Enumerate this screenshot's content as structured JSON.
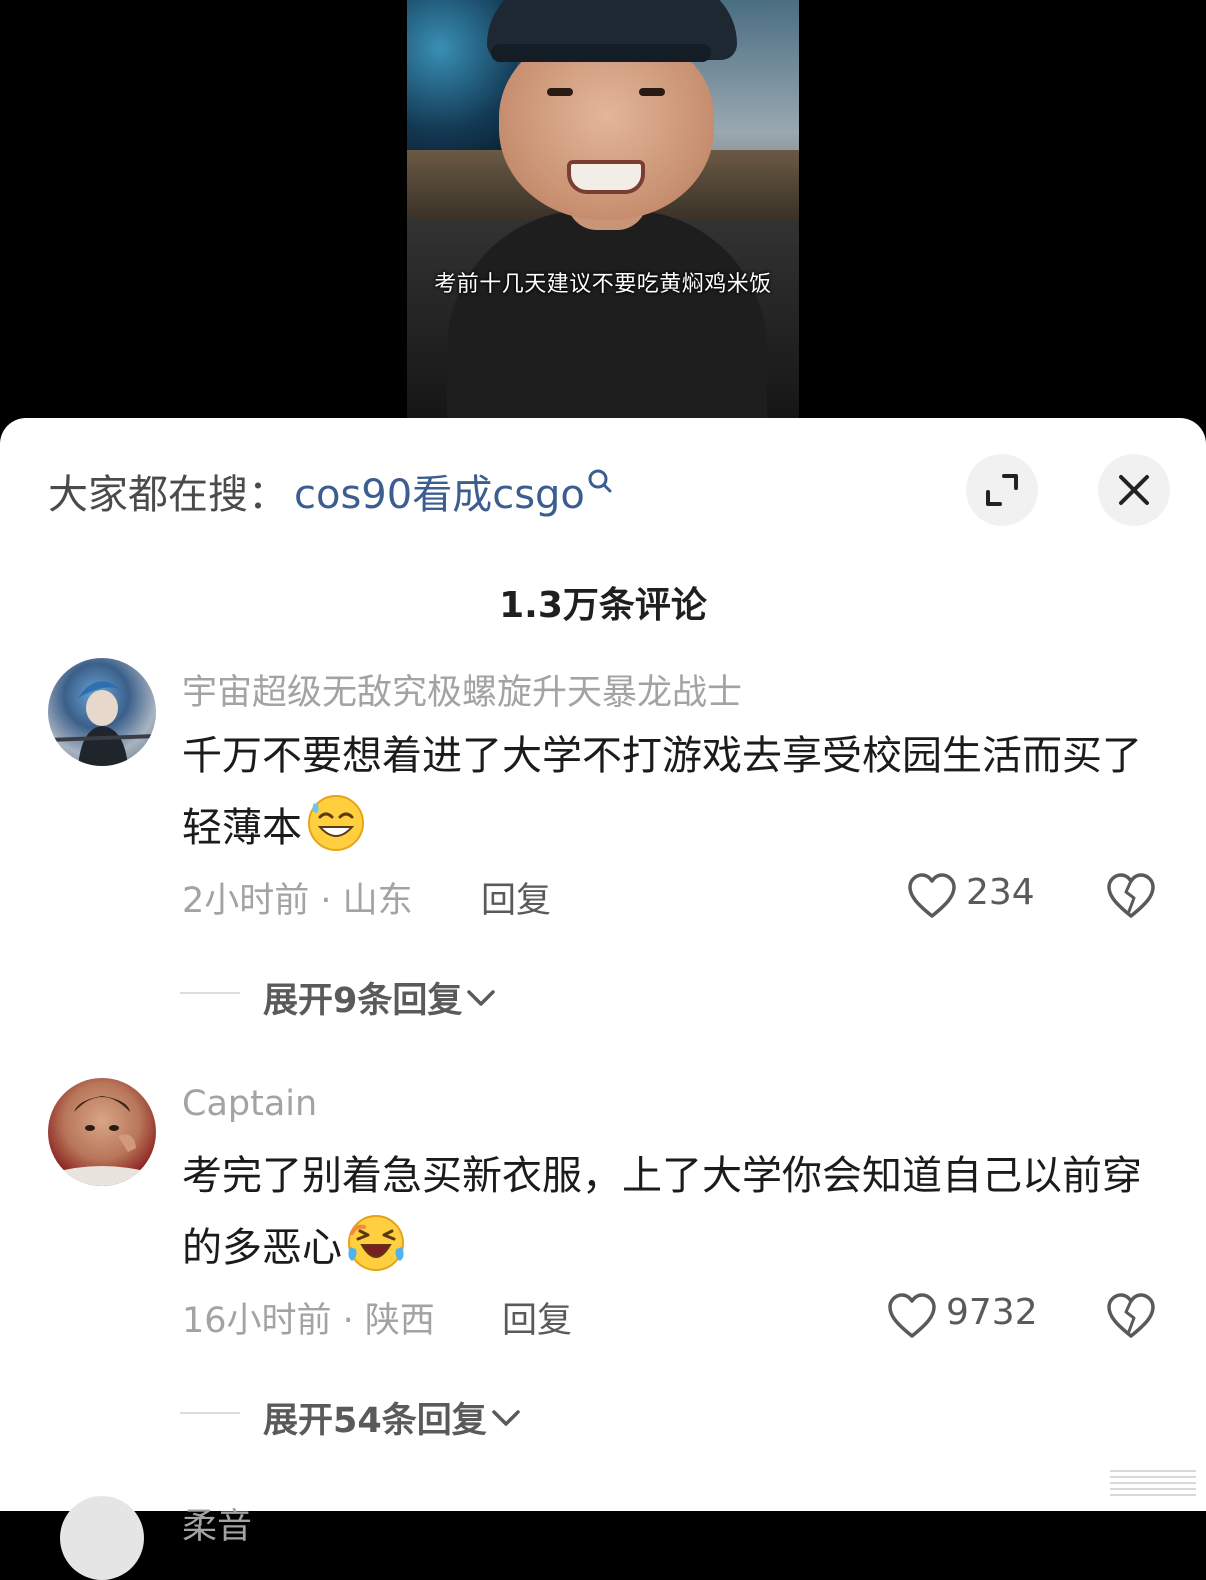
{
  "video": {
    "subtitle": "考前十几天建议不要吃黄焖鸡米饭"
  },
  "search": {
    "prefix": "大家都在搜：",
    "term": "cos90看成csgo"
  },
  "header": {
    "comment_count": "1.3万条评论"
  },
  "comments": [
    {
      "username": "宇宙超级无敌究极螺旋升天暴龙战士",
      "text": "千万不要想着进了大学不打游戏去享受校园生活而买了轻薄本",
      "emoji": "grinning-sweat-emoji",
      "meta": "2小时前 · 山东",
      "reply_label": "回复",
      "likes": "234",
      "expand_label": "展开9条回复"
    },
    {
      "username": "Captain",
      "text": "考完了别着急买新衣服，上了大学你会知道自己以前穿的多恶心",
      "emoji": "rolling-laugh-emoji",
      "meta": "16小时前 · 陕西",
      "reply_label": "回复",
      "likes": "9732",
      "expand_label": "展开54条回复"
    }
  ],
  "peek": {
    "username": "柔音"
  },
  "colors": {
    "search_term": "#3c5d8f",
    "muted": "#a3a3a3",
    "body_text": "#1b1b1b"
  }
}
